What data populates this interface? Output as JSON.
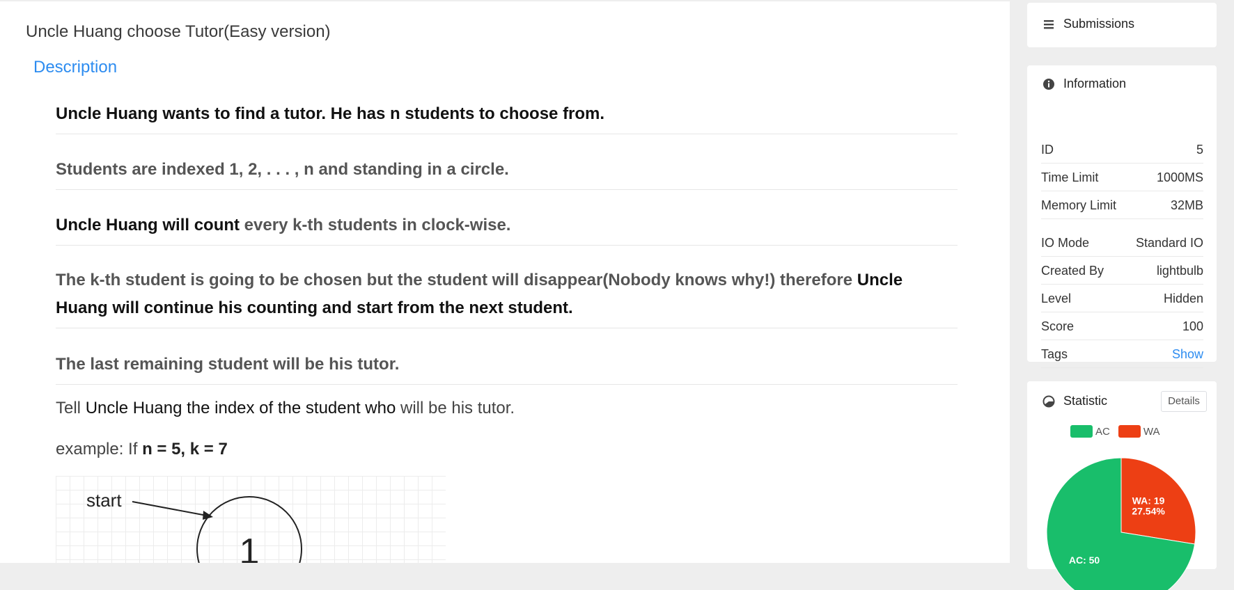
{
  "problem": {
    "title": "Uncle Huang choose Tutor(Easy version)",
    "description_label": "Description",
    "p1": "Uncle Huang wants to find a tutor. He has n students to choose from.",
    "p2": "Students are indexed 1, 2, . . . , n and standing in a circle.",
    "p3_bold": "Uncle Huang will count",
    "p3_rest": " every k-th students in clock-wise.",
    "p4_a": "The k-th student is going to be chosen but the student will disappear(Nobody knows why!) therefore ",
    "p4_b": "Uncle Huang will continue his counting and start from the next student.",
    "p5": "The last remaining student will be his tutor.",
    "p6_a": "Tell ",
    "p6_b": "Uncle Huang the index of the student who",
    "p6_c": " will be his tutor.",
    "ex_a": "example: If ",
    "ex_b": "n = 5, k = 7",
    "figure_start": "start",
    "figure_node": "1"
  },
  "sidebar": {
    "submissions_label": "Submissions",
    "information_label": "Information",
    "info": {
      "id_k": "ID",
      "id_v": "5",
      "time_k": "Time Limit",
      "time_v": "1000MS",
      "mem_k": "Memory Limit",
      "mem_v": "32MB",
      "io_k": "IO Mode",
      "io_v": "Standard IO",
      "created_k": "Created By",
      "created_v": "lightbulb",
      "level_k": "Level",
      "level_v": "Hidden",
      "score_k": "Score",
      "score_v": "100",
      "tags_k": "Tags",
      "tags_v": "Show"
    },
    "statistic_label": "Statistic",
    "details_label": "Details"
  },
  "chart_data": {
    "type": "pie",
    "legend": [
      "AC",
      "WA"
    ],
    "colors": {
      "AC": "#19be6b",
      "WA": "#ed3f14"
    },
    "slices": [
      {
        "name": "AC",
        "value": 50,
        "label_line1": "AC: 50"
      },
      {
        "name": "WA",
        "value": 19,
        "label_line1": "WA: 19",
        "label_line2": "27.54%"
      }
    ]
  }
}
